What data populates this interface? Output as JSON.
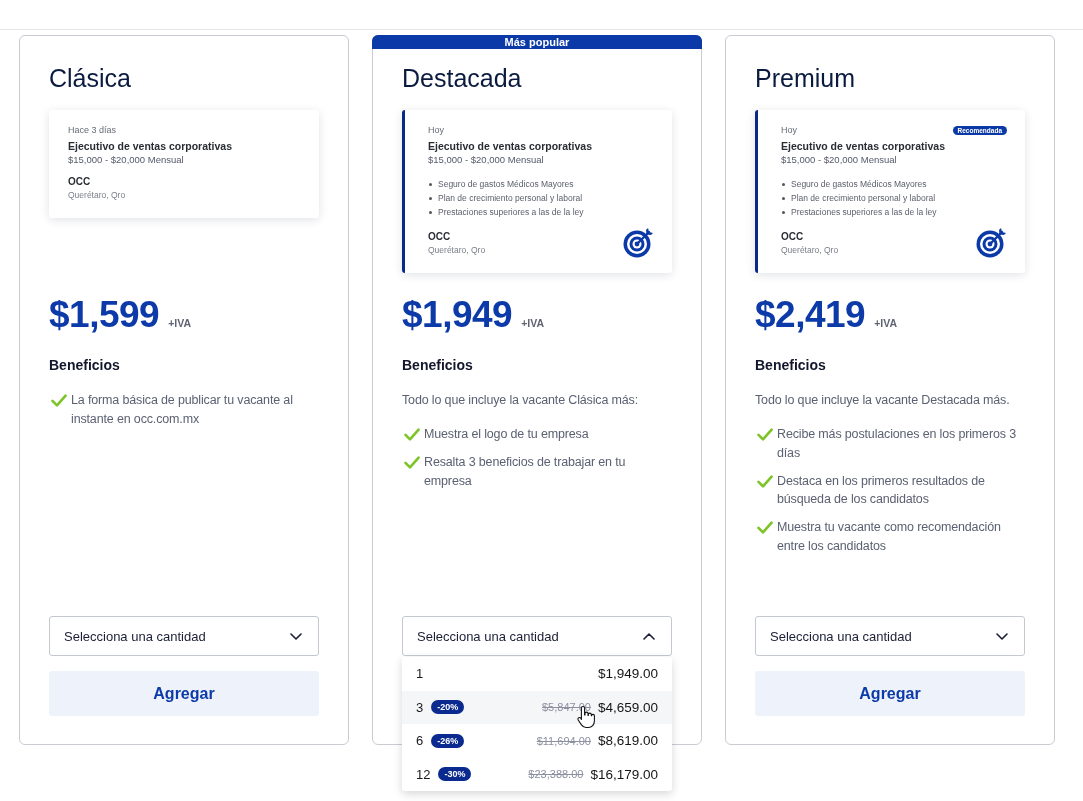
{
  "plans": [
    {
      "title": "Clásica",
      "preview": {
        "kind": "basic",
        "posted": "Hace 3 días",
        "job_title": "Ejecutivo de ventas corporativas",
        "salary": "$15,000 - $20,000 Mensual",
        "company": "OCC",
        "location": "Querétaro, Qro"
      },
      "price": "$1,599",
      "tax_note": "+IVA",
      "benefits_title": "Beneficios",
      "benefits": [
        "La forma básica de publicar tu vacante al instante en occ.com.mx"
      ],
      "quantity_select": {
        "label": "Selecciona una cantidad",
        "expanded": false
      },
      "add_button": "Agregar"
    },
    {
      "band": "Más popular",
      "title": "Destacada",
      "preview": {
        "kind": "featured",
        "posted": "Hoy",
        "job_title": "Ejecutivo de ventas corporativas",
        "salary": "$15,000 - $20,000 Mensual",
        "perks": [
          "Seguro de gastos Médicos Mayores",
          "Plan de crecimiento personal y laboral",
          "Prestaciones superiores a las de la ley"
        ],
        "company": "OCC",
        "location": "Querétaro, Qro"
      },
      "price": "$1,949",
      "tax_note": "+IVA",
      "benefits_title": "Beneficios",
      "benefits_intro": "Todo lo que incluye la vacante Clásica más:",
      "benefits": [
        "Muestra el logo de tu empresa",
        "Resalta 3 beneficios de trabajar en tu empresa"
      ],
      "quantity_select": {
        "label": "Selecciona una cantidad",
        "expanded": true,
        "options": [
          {
            "quantity": "1",
            "price": "$1,949.00",
            "highlighted": false
          },
          {
            "quantity": "3",
            "discount": "-20%",
            "list_price": "$5,847.00",
            "price": "$4,659.00",
            "highlighted": true
          },
          {
            "quantity": "6",
            "discount": "-26%",
            "list_price": "$11,694.00",
            "price": "$8,619.00",
            "highlighted": false
          },
          {
            "quantity": "12",
            "discount": "-30%",
            "list_price": "$23,388.00",
            "price": "$16,179.00",
            "highlighted": false
          }
        ]
      }
    },
    {
      "title": "Premium",
      "preview": {
        "kind": "featured",
        "posted": "Hoy",
        "badge": "Recomendada",
        "job_title": "Ejecutivo de ventas corporativas",
        "salary": "$15,000 - $20,000 Mensual",
        "perks": [
          "Seguro de gastos Médicos Mayores",
          "Plan de crecimiento personal y laboral",
          "Prestaciones superiores a las de la ley"
        ],
        "company": "OCC",
        "location": "Querétaro, Qro"
      },
      "price": "$2,419",
      "tax_note": "+IVA",
      "benefits_title": "Beneficios",
      "benefits_intro": "Todo lo que incluye la vacante Destacada más.",
      "benefits": [
        "Recibe más postulaciones en los primeros 3 días",
        "Destaca en los primeros resultados de búsqueda de los candidatos",
        "Muestra tu vacante como recomendación entre los candidatos"
      ],
      "quantity_select": {
        "label": "Selecciona una cantidad",
        "expanded": false
      },
      "add_button": "Agregar"
    }
  ]
}
